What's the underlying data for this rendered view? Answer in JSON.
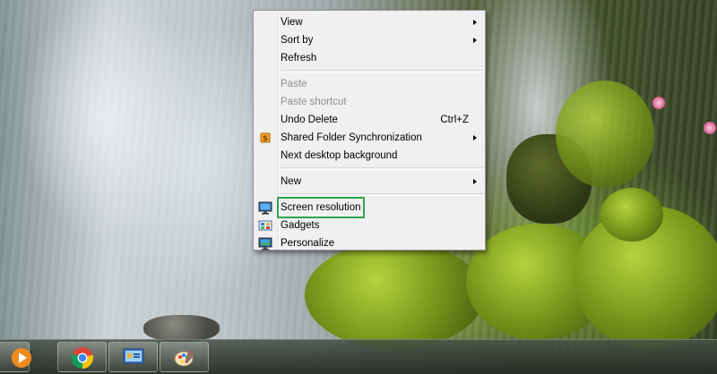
{
  "context_menu": {
    "items": [
      {
        "label": "View",
        "has_submenu": true
      },
      {
        "label": "Sort by",
        "has_submenu": true
      },
      {
        "label": "Refresh"
      },
      {
        "label": "Paste",
        "disabled": true
      },
      {
        "label": "Paste shortcut",
        "disabled": true
      },
      {
        "label": "Undo Delete",
        "shortcut": "Ctrl+Z"
      },
      {
        "label": "Shared Folder Synchronization",
        "has_submenu": true,
        "icon": "sync-icon"
      },
      {
        "label": "Next desktop background"
      },
      {
        "label": "New",
        "has_submenu": true
      },
      {
        "label": "Screen resolution",
        "icon": "monitor-icon",
        "highlighted": true
      },
      {
        "label": "Gadgets",
        "icon": "gadgets-icon"
      },
      {
        "label": "Personalize",
        "icon": "personalize-icon"
      }
    ],
    "highlight_color": "#2ea54a"
  },
  "taskbar": {
    "buttons": [
      {
        "icon": "media-player-icon"
      },
      {
        "icon": "chrome-icon"
      },
      {
        "icon": "control-panel-icon"
      },
      {
        "icon": "paint-icon"
      }
    ]
  }
}
